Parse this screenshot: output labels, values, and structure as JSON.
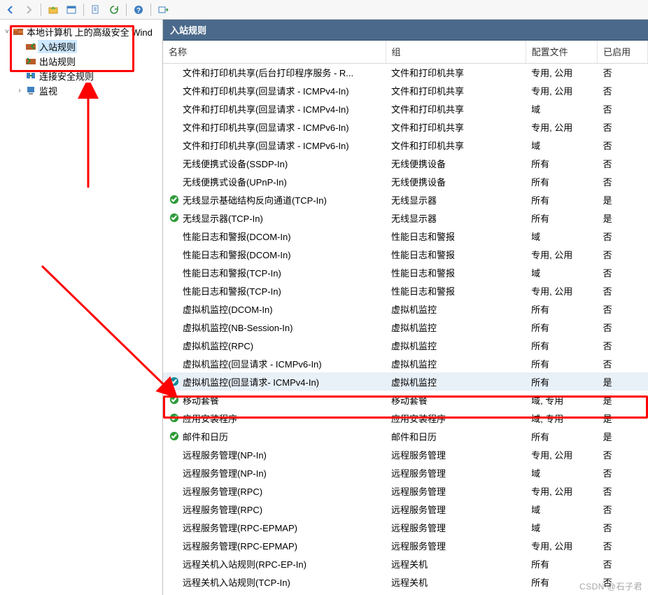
{
  "toolbar_icons": [
    "back",
    "forward",
    "up",
    "detail",
    "new",
    "refresh",
    "help",
    "action"
  ],
  "tree": {
    "root": "本地计算机 上的高级安全 Wind",
    "items": [
      {
        "label": "入站规则",
        "selected": true
      },
      {
        "label": "出站规则",
        "selected": false
      },
      {
        "label": "连接安全规则",
        "selected": false
      },
      {
        "label": "监视",
        "selected": false,
        "expandable": true
      }
    ]
  },
  "pane_title": "入站规则",
  "columns": {
    "name": "名称",
    "group": "组",
    "profile": "配置文件",
    "enabled": "已启用"
  },
  "rules": [
    {
      "icon": "",
      "name": "文件和打印机共享(后台打印程序服务 - R...",
      "group": "文件和打印机共享",
      "profile": "专用, 公用",
      "enabled": "否"
    },
    {
      "icon": "",
      "name": "文件和打印机共享(回显请求 - ICMPv4-In)",
      "group": "文件和打印机共享",
      "profile": "专用, 公用",
      "enabled": "否"
    },
    {
      "icon": "",
      "name": "文件和打印机共享(回显请求 - ICMPv4-In)",
      "group": "文件和打印机共享",
      "profile": "域",
      "enabled": "否"
    },
    {
      "icon": "",
      "name": "文件和打印机共享(回显请求 - ICMPv6-In)",
      "group": "文件和打印机共享",
      "profile": "专用, 公用",
      "enabled": "否"
    },
    {
      "icon": "",
      "name": "文件和打印机共享(回显请求 - ICMPv6-In)",
      "group": "文件和打印机共享",
      "profile": "域",
      "enabled": "否"
    },
    {
      "icon": "",
      "name": "无线便携式设备(SSDP-In)",
      "group": "无线便携设备",
      "profile": "所有",
      "enabled": "否"
    },
    {
      "icon": "",
      "name": "无线便携式设备(UPnP-In)",
      "group": "无线便携设备",
      "profile": "所有",
      "enabled": "否"
    },
    {
      "icon": "check",
      "name": "无线显示基础结构反向通道(TCP-In)",
      "group": "无线显示器",
      "profile": "所有",
      "enabled": "是"
    },
    {
      "icon": "check",
      "name": "无线显示器(TCP-In)",
      "group": "无线显示器",
      "profile": "所有",
      "enabled": "是"
    },
    {
      "icon": "",
      "name": "性能日志和警报(DCOM-In)",
      "group": "性能日志和警报",
      "profile": "域",
      "enabled": "否"
    },
    {
      "icon": "",
      "name": "性能日志和警报(DCOM-In)",
      "group": "性能日志和警报",
      "profile": "专用, 公用",
      "enabled": "否"
    },
    {
      "icon": "",
      "name": "性能日志和警报(TCP-In)",
      "group": "性能日志和警报",
      "profile": "域",
      "enabled": "否"
    },
    {
      "icon": "",
      "name": "性能日志和警报(TCP-In)",
      "group": "性能日志和警报",
      "profile": "专用, 公用",
      "enabled": "否"
    },
    {
      "icon": "",
      "name": "虚拟机监控(DCOM-In)",
      "group": "虚拟机监控",
      "profile": "所有",
      "enabled": "否"
    },
    {
      "icon": "",
      "name": "虚拟机监控(NB-Session-In)",
      "group": "虚拟机监控",
      "profile": "所有",
      "enabled": "否"
    },
    {
      "icon": "",
      "name": "虚拟机监控(RPC)",
      "group": "虚拟机监控",
      "profile": "所有",
      "enabled": "否"
    },
    {
      "icon": "",
      "name": "虚拟机监控(回显请求 - ICMPv6-In)",
      "group": "虚拟机监控",
      "profile": "所有",
      "enabled": "否"
    },
    {
      "icon": "teal",
      "name": "虚拟机监控(回显请求- ICMPv4-In)",
      "group": "虚拟机监控",
      "profile": "所有",
      "enabled": "是",
      "selected": true
    },
    {
      "icon": "check",
      "name": "移动套餐",
      "group": "移动套餐",
      "profile": "域, 专用",
      "enabled": "是"
    },
    {
      "icon": "check",
      "name": "应用安装程序",
      "group": "应用安装程序",
      "profile": "域, 专用",
      "enabled": "是"
    },
    {
      "icon": "check",
      "name": "邮件和日历",
      "group": "邮件和日历",
      "profile": "所有",
      "enabled": "是"
    },
    {
      "icon": "",
      "name": "远程服务管理(NP-In)",
      "group": "远程服务管理",
      "profile": "专用, 公用",
      "enabled": "否"
    },
    {
      "icon": "",
      "name": "远程服务管理(NP-In)",
      "group": "远程服务管理",
      "profile": "域",
      "enabled": "否"
    },
    {
      "icon": "",
      "name": "远程服务管理(RPC)",
      "group": "远程服务管理",
      "profile": "专用, 公用",
      "enabled": "否"
    },
    {
      "icon": "",
      "name": "远程服务管理(RPC)",
      "group": "远程服务管理",
      "profile": "域",
      "enabled": "否"
    },
    {
      "icon": "",
      "name": "远程服务管理(RPC-EPMAP)",
      "group": "远程服务管理",
      "profile": "域",
      "enabled": "否"
    },
    {
      "icon": "",
      "name": "远程服务管理(RPC-EPMAP)",
      "group": "远程服务管理",
      "profile": "专用, 公用",
      "enabled": "否"
    },
    {
      "icon": "",
      "name": "远程关机入站规则(RPC-EP-In)",
      "group": "远程关机",
      "profile": "所有",
      "enabled": "否"
    },
    {
      "icon": "",
      "name": "远程关机入站规则(TCP-In)",
      "group": "远程关机",
      "profile": "所有",
      "enabled": "否"
    }
  ],
  "watermark": "CSDN @石子君"
}
